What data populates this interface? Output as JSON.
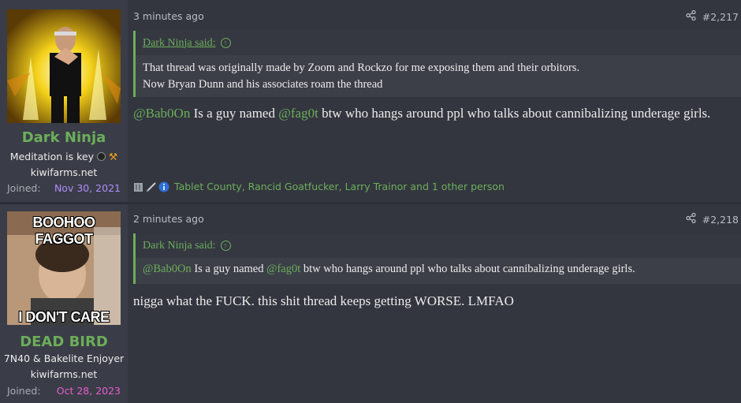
{
  "posts": [
    {
      "author": {
        "name": "Dark Ninja",
        "title": "Meditation is key",
        "site": "kiwifarms.net",
        "joined_label": "Joined:",
        "joined_date": "Nov 30, 2021",
        "name_color": "#6cae5a",
        "date_color": "#b38cff",
        "avatar_icon": "flame-aura-avatar"
      },
      "time": "3 minutes ago",
      "number": "#2,217",
      "quote": {
        "author_said": "Dark Ninja said:",
        "lines": [
          "That thread was originally made by Zoom and Rockzo for me exposing them and their orbitors.",
          "Now Bryan Dunn and his associates roam the thread"
        ]
      },
      "message": {
        "mention1": "@Bab0On",
        "text1": " Is a guy named ",
        "mention2": "@fag0t",
        "text2": " btw who hangs around ppl who talks about cannibalizing underage girls."
      },
      "reactions": {
        "icons": [
          "tablet-icon",
          "pencil-icon",
          "info-icon"
        ],
        "names": "Tablet County, Rancid Goatfucker, Larry Trainor and 1 other person"
      }
    },
    {
      "author": {
        "name": "DEAD BIRD",
        "title": "7N40 & Bakelite Enjoyer",
        "site": "kiwifarms.net",
        "joined_label": "Joined:",
        "joined_date": "Oct 28, 2023",
        "name_color": "#6cae5a",
        "date_color": "#e85cd0",
        "avatar_top_text": "BOOHOO FAGGOT",
        "avatar_bottom_text": "I DON'T CARE"
      },
      "time": "2 minutes ago",
      "number": "#2,218",
      "quote": {
        "author_said": "Dark Ninja said:",
        "mention1": "@Bab0On",
        "text1": " Is a guy named ",
        "mention2": "@fag0t",
        "text2": " btw who hangs around ppl who talks about cannibalizing underage girls."
      },
      "message": "nigga what the FUCK. this shit thread keeps getting WORSE. LMFAO"
    }
  ]
}
